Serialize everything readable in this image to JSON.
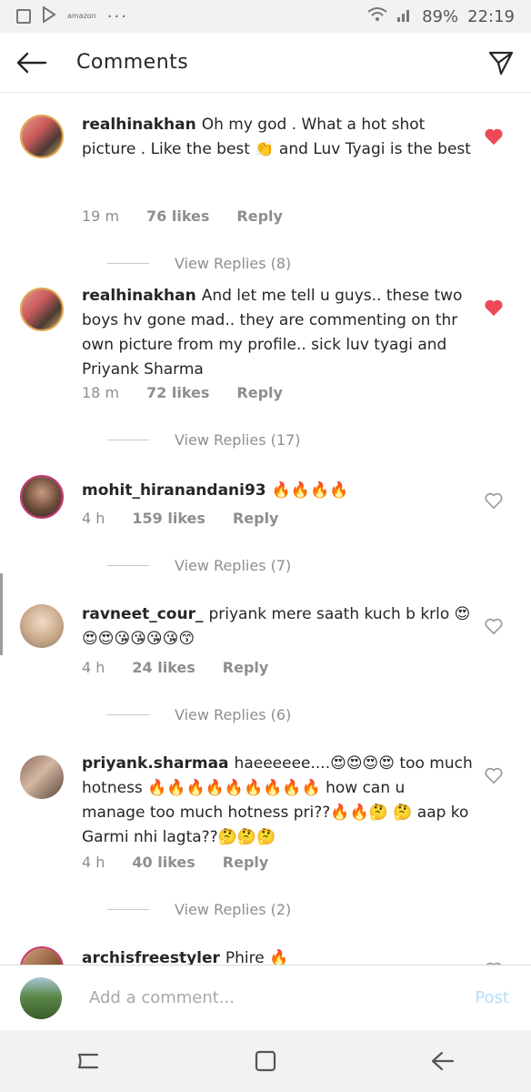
{
  "status_bar": {
    "icons": [
      "image-icon",
      "play-store-icon",
      "amazon-icon"
    ],
    "amazon_label": "amazon",
    "more": "···",
    "battery": "89%",
    "time": "22:19"
  },
  "header": {
    "title": "Comments"
  },
  "comments": [
    {
      "username": "realhinakhan",
      "text": "Oh my god . What a hot shot picture . Like the best 👏 and Luv Tyagi is the best",
      "time": "19 m",
      "likes": "76 likes",
      "reply": "Reply",
      "liked": true,
      "view_replies": "View Replies (8)"
    },
    {
      "username": "realhinakhan",
      "text": "And let me tell u guys.. these two boys hv gone mad.. they are commenting on thr own picture from my profile.. sick luv tyagi and Priyank Sharma",
      "time": "18 m",
      "likes": "72 likes",
      "reply": "Reply",
      "liked": true,
      "view_replies": "View Replies (17)"
    },
    {
      "username": "mohit_hiranandani93",
      "text": "🔥🔥🔥🔥",
      "time": "4 h",
      "likes": "159 likes",
      "reply": "Reply",
      "liked": false,
      "view_replies": "View Replies (7)"
    },
    {
      "username": "ravneet_cour_",
      "text": "priyank mere saath kuch b krlo 😍😍😍😘😘😘😘😙",
      "time": "4 h",
      "likes": "24 likes",
      "reply": "Reply",
      "liked": false,
      "view_replies": "View Replies (6)"
    },
    {
      "username": "priyank.sharmaa",
      "text": "haeeeeee....😍😍😍😍 too much hotness 🔥🔥🔥🔥🔥🔥🔥🔥🔥 how can u manage too much hotness pri??🔥🔥🤔 🤔 aap ko Garmi nhi lagta??🤔🤔🤔",
      "time": "4 h",
      "likes": "40 likes",
      "reply": "Reply",
      "liked": false,
      "view_replies": "View Replies (2)"
    },
    {
      "username": "archisfreestyler",
      "text": "Phire 🔥"
    }
  ],
  "composer": {
    "placeholder": "Add a comment...",
    "post_label": "Post"
  },
  "colors": {
    "liked_heart": "#ed4956",
    "post_disabled": "#b2dffc",
    "meta_gray": "#8e8e8e"
  }
}
